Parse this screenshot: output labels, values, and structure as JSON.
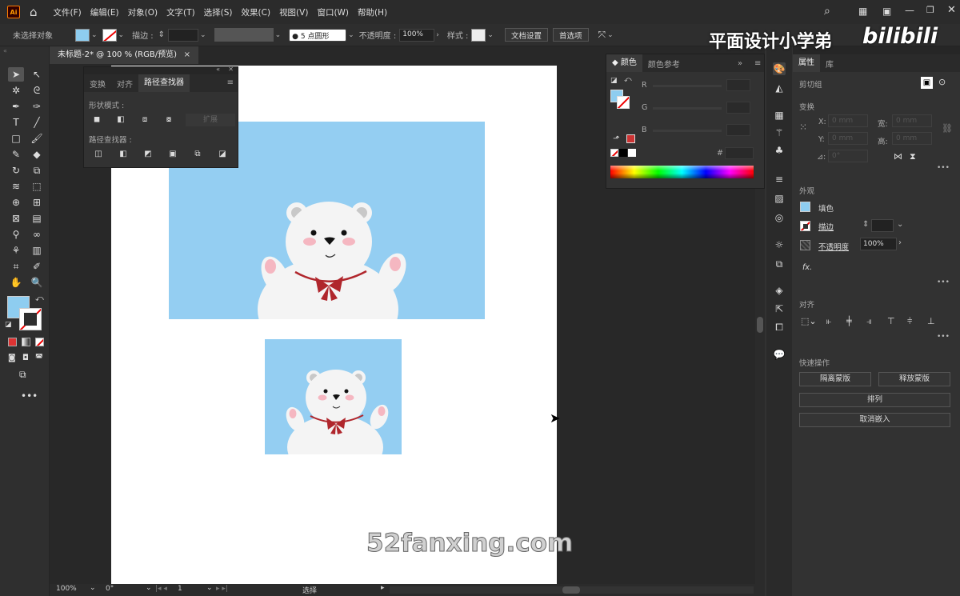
{
  "app": {
    "logo": "Ai",
    "home_icon": "home-icon"
  },
  "menu": [
    "文件(F)",
    "编辑(E)",
    "对象(O)",
    "文字(T)",
    "选择(S)",
    "效果(C)",
    "视图(V)",
    "窗口(W)",
    "帮助(H)"
  ],
  "control_bar": {
    "selection": "未选择对象",
    "stroke_label": "描边 :",
    "brush_dot": "●",
    "brush_size": "5",
    "brush_name": "点圆形",
    "opacity_label": "不透明度 :",
    "opacity_value": "100%",
    "style_label": "样式 :",
    "doc_setup": "文档设置",
    "preferences": "首选项"
  },
  "document": {
    "tab_title": "未标题-2* @ 100 % (RGB/预览)",
    "close": "×"
  },
  "pathfinder_panel": {
    "tabs": [
      "变换",
      "对齐",
      "路径查找器"
    ],
    "shape_modes": "形状模式 :",
    "expand": "扩展",
    "pathfinders": "路径查找器 :"
  },
  "color_panel": {
    "tabs": [
      "颜色",
      "颜色参考"
    ],
    "channels": [
      "R",
      "G",
      "B"
    ],
    "hex_label": "#"
  },
  "properties": {
    "tabs": [
      "属性",
      "库"
    ],
    "group_label": "剪切组",
    "transform_title": "变换",
    "x_label": "X:",
    "y_label": "Y:",
    "w_label": "宽:",
    "h_label": "高:",
    "x_value": "0 mm",
    "y_value": "0 mm",
    "w_value": "0 mm",
    "h_value": "0 mm",
    "angle_label": "⊿:",
    "angle_value": "0°",
    "appearance_title": "外观",
    "fill_label": "填色",
    "stroke_label": "描边",
    "opacity_label": "不透明度",
    "opacity_value": "100%",
    "fx_label": "fx.",
    "align_title": "对齐",
    "quick_actions_title": "快速操作",
    "isolate_mask": "隔离蒙版",
    "release_mask": "释放蒙版",
    "arrange": "排列",
    "unembed": "取消嵌入"
  },
  "status_bar": {
    "zoom": "100%",
    "rotation": "0°",
    "artboard": "1",
    "tool": "选择"
  },
  "overlays": {
    "channel_name": "平面设计小学弟",
    "bilibili": "bilibili",
    "watermark": "52fanxing.com"
  },
  "colors": {
    "fill": "#8ecdf0",
    "artwork_bg": "#94cef2",
    "bear": "#f4f4f4",
    "bow": "#b0262c",
    "cheek": "#f5b7c1",
    "accent_orange": "#ff7c00"
  }
}
